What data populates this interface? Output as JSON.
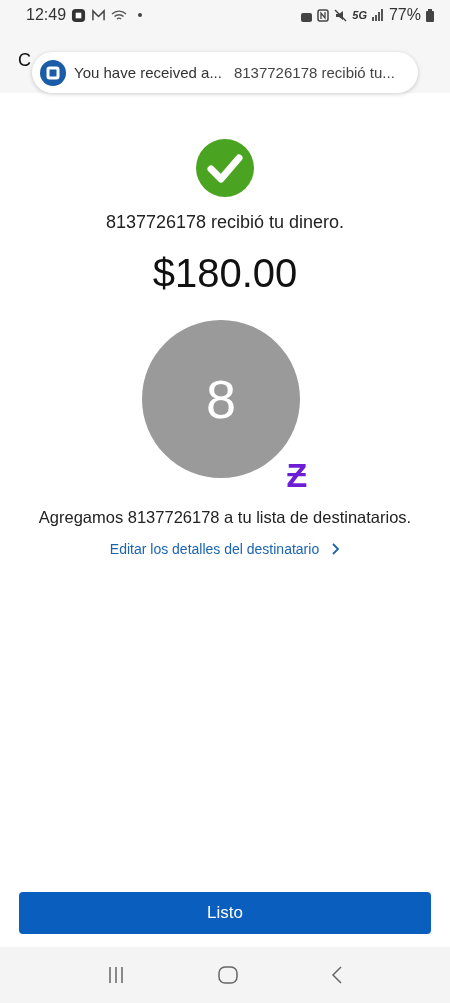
{
  "status_bar": {
    "time": "12:49",
    "battery": "77%",
    "network": "5G"
  },
  "header": {
    "title": "C"
  },
  "notification": {
    "title": "You have received a...",
    "message": "8137726178 recibió tu..."
  },
  "confirmation": {
    "message": "8137726178 recibió tu dinero.",
    "amount": "$180.00"
  },
  "recipient": {
    "initial": "8",
    "badge": "Ƶ"
  },
  "added_message": "Agregamos 8137726178 a tu lista de destinatarios.",
  "edit_link": "Editar los detalles del destinatario",
  "done_button": "Listo"
}
